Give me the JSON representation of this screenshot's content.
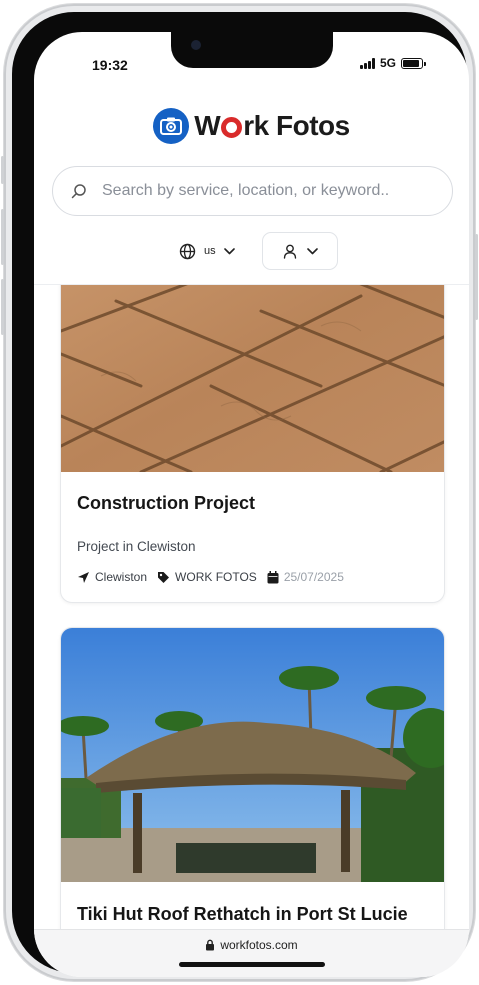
{
  "status_bar": {
    "time": "19:32",
    "network": "5G",
    "battery_level": 0.9,
    "icons": [
      "signal-icon",
      "battery-icon"
    ]
  },
  "header": {
    "logo_text_before": "W",
    "logo_text_after": "rk Fotos",
    "logo_icon": "camera-icon",
    "brand_colors": {
      "blue": "#1561c4",
      "red": "#d92b2b"
    }
  },
  "search": {
    "placeholder": "Search by service, location, or keyword.."
  },
  "controls": {
    "language": "us",
    "globe_icon": "globe-icon",
    "user_icon": "user-icon"
  },
  "cards": [
    {
      "title": "Construction Project",
      "subtitle": "Project in Clewiston",
      "location": "Clewiston",
      "tag": "WORK FOTOS",
      "date": "25/07/2025",
      "image": "stamped concrete pavers"
    },
    {
      "title": "Tiki Hut Roof Rethatch in Port St Lucie",
      "image": "thatched tiki hut with palm trees"
    }
  ],
  "browser": {
    "url": "workfotos.com"
  }
}
